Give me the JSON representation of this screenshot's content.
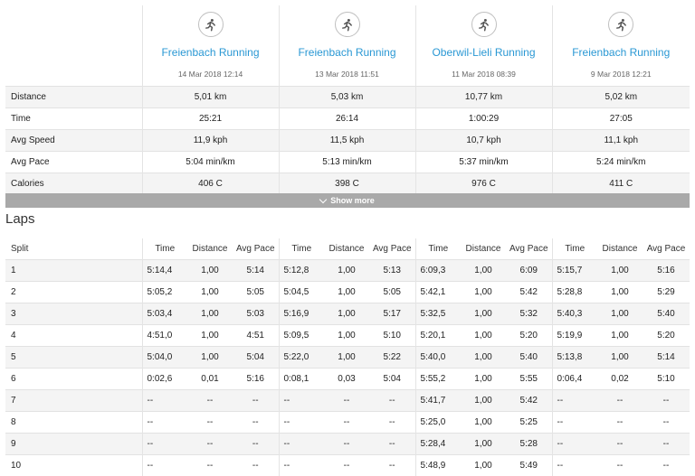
{
  "activities": [
    {
      "name": "Freienbach Running",
      "date": "14 Mar 2018 12:14"
    },
    {
      "name": "Freienbach Running",
      "date": "13 Mar 2018 11:51"
    },
    {
      "name": "Oberwil-Lieli Running",
      "date": "11 Mar 2018 08:39"
    },
    {
      "name": "Freienbach Running",
      "date": "9 Mar 2018 12:21"
    }
  ],
  "activity_icon": "running-person-icon",
  "accent_color": "#2a98d4",
  "metrics": [
    {
      "label": "Distance",
      "values": [
        "5,01 km",
        "5,03 km",
        "10,77 km",
        "5,02 km"
      ]
    },
    {
      "label": "Time",
      "values": [
        "25:21",
        "26:14",
        "1:00:29",
        "27:05"
      ]
    },
    {
      "label": "Avg Speed",
      "values": [
        "11,9 kph",
        "11,5 kph",
        "10,7 kph",
        "11,1 kph"
      ]
    },
    {
      "label": "Avg Pace",
      "values": [
        "5:04 min/km",
        "5:13 min/km",
        "5:37 min/km",
        "5:24 min/km"
      ]
    },
    {
      "label": "Calories",
      "values": [
        "406 C",
        "398 C",
        "976 C",
        "411 C"
      ]
    }
  ],
  "show_more_label": "Show more",
  "laps": {
    "title": "Laps",
    "split_header": "Split",
    "column_headers": [
      "Time",
      "Distance",
      "Avg Pace"
    ],
    "rows": [
      {
        "split": "1",
        "cells": [
          "5:14,4",
          "1,00",
          "5:14",
          "5:12,8",
          "1,00",
          "5:13",
          "6:09,3",
          "1,00",
          "6:09",
          "5:15,7",
          "1,00",
          "5:16"
        ]
      },
      {
        "split": "2",
        "cells": [
          "5:05,2",
          "1,00",
          "5:05",
          "5:04,5",
          "1,00",
          "5:05",
          "5:42,1",
          "1,00",
          "5:42",
          "5:28,8",
          "1,00",
          "5:29"
        ]
      },
      {
        "split": "3",
        "cells": [
          "5:03,4",
          "1,00",
          "5:03",
          "5:16,9",
          "1,00",
          "5:17",
          "5:32,5",
          "1,00",
          "5:32",
          "5:40,3",
          "1,00",
          "5:40"
        ]
      },
      {
        "split": "4",
        "cells": [
          "4:51,0",
          "1,00",
          "4:51",
          "5:09,5",
          "1,00",
          "5:10",
          "5:20,1",
          "1,00",
          "5:20",
          "5:19,9",
          "1,00",
          "5:20"
        ]
      },
      {
        "split": "5",
        "cells": [
          "5:04,0",
          "1,00",
          "5:04",
          "5:22,0",
          "1,00",
          "5:22",
          "5:40,0",
          "1,00",
          "5:40",
          "5:13,8",
          "1,00",
          "5:14"
        ]
      },
      {
        "split": "6",
        "cells": [
          "0:02,6",
          "0,01",
          "5:16",
          "0:08,1",
          "0,03",
          "5:04",
          "5:55,2",
          "1,00",
          "5:55",
          "0:06,4",
          "0,02",
          "5:10"
        ]
      },
      {
        "split": "7",
        "cells": [
          "--",
          "--",
          "--",
          "--",
          "--",
          "--",
          "5:41,7",
          "1,00",
          "5:42",
          "--",
          "--",
          "--"
        ]
      },
      {
        "split": "8",
        "cells": [
          "--",
          "--",
          "--",
          "--",
          "--",
          "--",
          "5:25,0",
          "1,00",
          "5:25",
          "--",
          "--",
          "--"
        ]
      },
      {
        "split": "9",
        "cells": [
          "--",
          "--",
          "--",
          "--",
          "--",
          "--",
          "5:28,4",
          "1,00",
          "5:28",
          "--",
          "--",
          "--"
        ]
      },
      {
        "split": "10",
        "cells": [
          "--",
          "--",
          "--",
          "--",
          "--",
          "--",
          "5:48,9",
          "1,00",
          "5:49",
          "--",
          "--",
          "--"
        ]
      }
    ]
  }
}
